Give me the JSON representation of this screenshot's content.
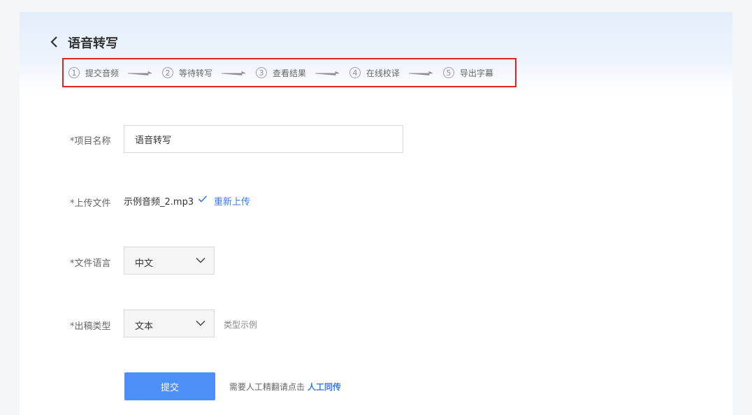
{
  "header": {
    "title": "语音转写",
    "back_icon": "chevron-left-icon"
  },
  "steps": [
    {
      "num": "1",
      "label": "提交音频"
    },
    {
      "num": "2",
      "label": "等待转写"
    },
    {
      "num": "3",
      "label": "查看结果"
    },
    {
      "num": "4",
      "label": "在线校译"
    },
    {
      "num": "5",
      "label": "导出字幕"
    }
  ],
  "form": {
    "project_name": {
      "label": "*项目名称",
      "value": "语音转写"
    },
    "upload": {
      "label": "*上传文件",
      "file_name": "示例音频_2.mp3",
      "reupload": "重新上传"
    },
    "language": {
      "label": "*文件语言",
      "selected": "中文"
    },
    "output_type": {
      "label": "*出稿类型",
      "selected": "文本",
      "example_link": "类型示例"
    },
    "submit_label": "提交",
    "hint": "需要人工精翻请点击",
    "human_link": "人工同传"
  },
  "colors": {
    "accent": "#4d8ef7",
    "link": "#3a7be6",
    "highlight_border": "#e0271a"
  }
}
